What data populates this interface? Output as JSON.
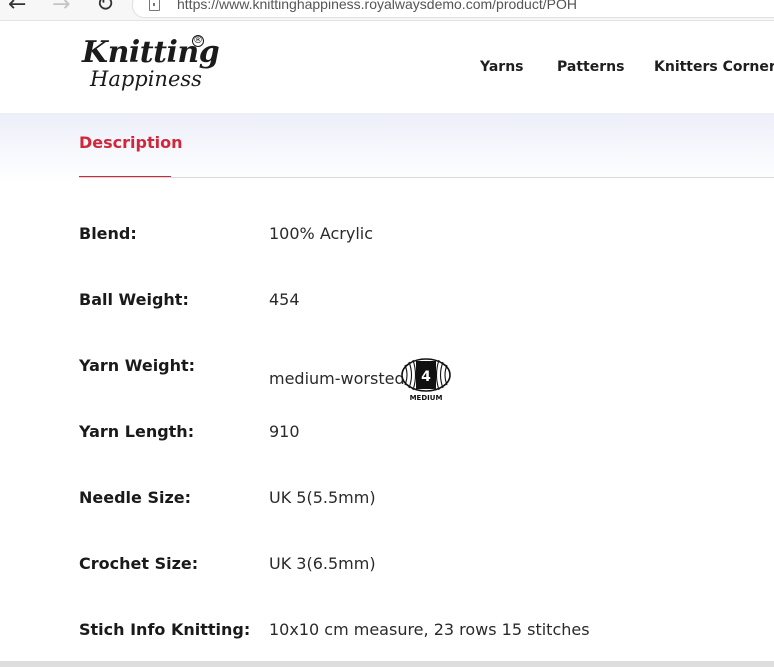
{
  "browser": {
    "url": "https://www.knittinghappiness.royalwaysdemo.com/product/POH",
    "back_icon": "←",
    "forward_icon": "→",
    "reload_icon": "↻"
  },
  "logo": {
    "line1": "Knitting",
    "line2": "Happiness",
    "registered": "®"
  },
  "nav": {
    "items": [
      {
        "label": "Yarns"
      },
      {
        "label": "Patterns"
      },
      {
        "label": "Knitters Corner"
      }
    ]
  },
  "tabs": {
    "active": "Description",
    "accent_color": "#d0283a"
  },
  "specs": [
    {
      "label": "Blend:",
      "value": "100% Acrylic"
    },
    {
      "label": "Ball Weight:",
      "value": "454"
    },
    {
      "label": "Yarn Weight:",
      "value": "medium-worsted",
      "badge_number": "4",
      "badge_text": "MEDIUM"
    },
    {
      "label": "Yarn Length:",
      "value": "910"
    },
    {
      "label": "Needle Size:",
      "value": "UK 5(5.5mm)"
    },
    {
      "label": "Crochet Size:",
      "value": "UK 3(6.5mm)"
    },
    {
      "label": "Stich Info Knitting:",
      "value": "10x10 cm measure, 23 rows 15 stitches"
    }
  ]
}
